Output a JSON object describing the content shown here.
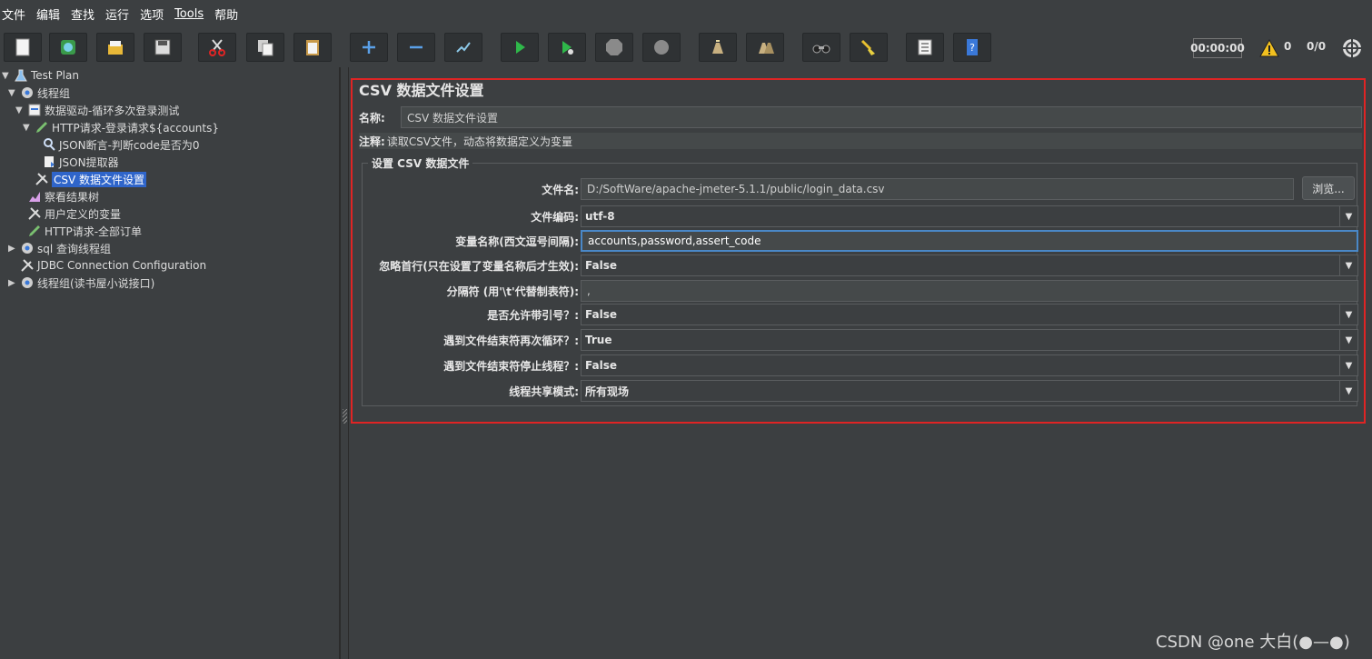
{
  "menubar": {
    "items": [
      "文件",
      "编辑",
      "查找",
      "运行",
      "选项",
      "Tools",
      "帮助"
    ]
  },
  "toolbar": {
    "timer": "00:00:00",
    "warning_count": "0",
    "thread_count": "0/0",
    "icons": [
      "new-icon",
      "templates-icon",
      "open-icon",
      "save-icon",
      "cut-icon",
      "copy-icon",
      "paste-icon",
      "expand-icon",
      "collapse-icon",
      "toggle-icon",
      "start-icon",
      "start-no-pause-icon",
      "stop-icon",
      "shutdown-icon",
      "clear-icon",
      "clear-all-icon",
      "search-icon",
      "reset-search-icon",
      "function-helper-icon",
      "help-icon"
    ]
  },
  "tree": {
    "nodes": [
      {
        "label": "Test Plan",
        "icon": "test-plan-icon",
        "expanded": true
      },
      {
        "label": "线程组",
        "icon": "gear-icon",
        "expanded": true
      },
      {
        "label": "数据驱动-循环多次登录测试",
        "icon": "loop-controller-icon",
        "expanded": true
      },
      {
        "label": "HTTP请求-登录请求${accounts}",
        "icon": "sampler-pen-icon",
        "expanded": true
      },
      {
        "label": "JSON断言-判断code是否为0",
        "icon": "assertion-icon"
      },
      {
        "label": "JSON提取器",
        "icon": "extractor-icon"
      },
      {
        "label": "CSV 数据文件设置",
        "icon": "config-tools-icon",
        "selected": true
      },
      {
        "label": "察看结果树",
        "icon": "listener-icon"
      },
      {
        "label": "用户定义的变量",
        "icon": "config-tools-icon"
      },
      {
        "label": "HTTP请求-全部订单",
        "icon": "sampler-pen-icon"
      },
      {
        "label": "sql 查询线程组",
        "icon": "gear-icon",
        "expanded": false
      },
      {
        "label": "JDBC Connection Configuration",
        "icon": "config-tools-icon"
      },
      {
        "label": "线程组(读书屋小说接口)",
        "icon": "gear-icon",
        "expanded": false
      }
    ]
  },
  "panel": {
    "title": "CSV 数据文件设置",
    "name_label": "名称:",
    "name_value": "CSV 数据文件设置",
    "comment_label": "注释:",
    "comment_value": "读取CSV文件，动态将数据定义为变量",
    "group_title": "设置 CSV 数据文件",
    "browse_label": "浏览...",
    "fields": [
      {
        "label": "文件名:",
        "value": "D:/SoftWare/apache-jmeter-5.1.1/public/login_data.csv",
        "kind": "input"
      },
      {
        "label": "文件编码:",
        "value": "utf-8",
        "kind": "select"
      },
      {
        "label": "变量名称(西文逗号间隔):",
        "value": "accounts,password,assert_code",
        "kind": "input-active"
      },
      {
        "label": "忽略首行(只在设置了变量名称后才生效):",
        "value": "False",
        "kind": "select"
      },
      {
        "label": "分隔符 (用'\\t'代替制表符):",
        "value": ",",
        "kind": "input"
      },
      {
        "label": "是否允许带引号？:",
        "value": "False",
        "kind": "select"
      },
      {
        "label": "遇到文件结束符再次循环？:",
        "value": "True",
        "kind": "select"
      },
      {
        "label": "遇到文件结束符停止线程？:",
        "value": "False",
        "kind": "select"
      },
      {
        "label": "线程共享模式:",
        "value": "所有现场",
        "kind": "select"
      }
    ]
  },
  "watermark": "CSDN @one 大白(●—●)"
}
